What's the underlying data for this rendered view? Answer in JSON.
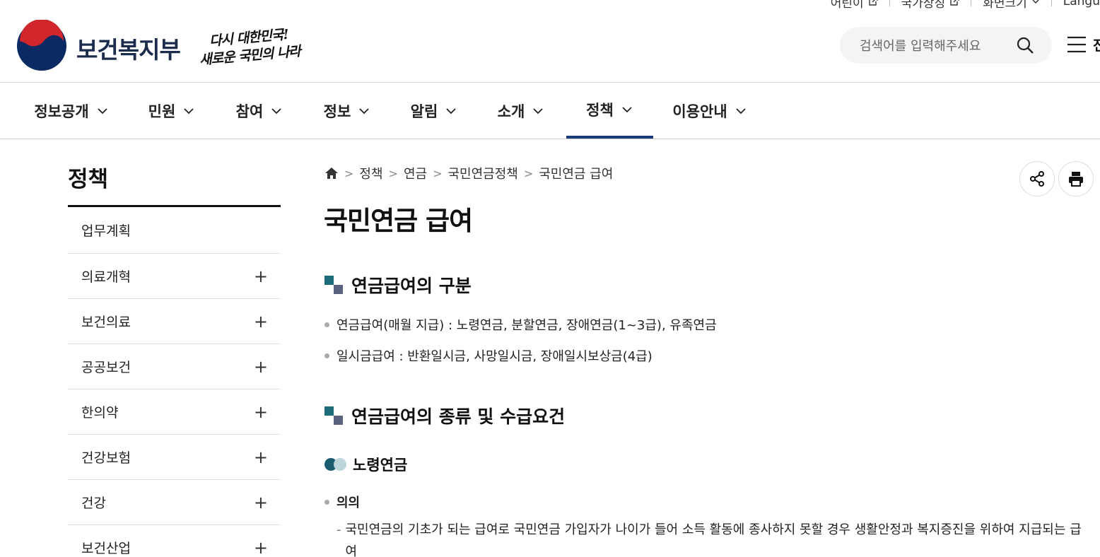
{
  "util": {
    "items": [
      {
        "label": "어린이",
        "icon": "external-link-icon"
      },
      {
        "label": "국가상징",
        "icon": "external-link-icon"
      },
      {
        "label": "화면크기",
        "icon": "chevron-down-icon"
      },
      {
        "label": "Langu",
        "icon": ""
      }
    ]
  },
  "header": {
    "ministry_name": "보건복지부",
    "slogan_line1": "다시 대한민국!",
    "slogan_line2": "새로운 국민의 나라",
    "search_placeholder": "검색어를 입력해주세요",
    "menu_cut_text": "전"
  },
  "gnb": {
    "items": [
      {
        "label": "정보공개"
      },
      {
        "label": "민원"
      },
      {
        "label": "참여"
      },
      {
        "label": "정보"
      },
      {
        "label": "알림"
      },
      {
        "label": "소개"
      },
      {
        "label": "정책"
      },
      {
        "label": "이용안내"
      }
    ],
    "active": "정책"
  },
  "sidebar": {
    "title": "정책",
    "items": [
      {
        "label": "업무계획",
        "expand": ""
      },
      {
        "label": "의료개혁",
        "expand": "+"
      },
      {
        "label": "보건의료",
        "expand": "+"
      },
      {
        "label": "공공보건",
        "expand": "+"
      },
      {
        "label": "한의약",
        "expand": "+"
      },
      {
        "label": "건강보험",
        "expand": "+"
      },
      {
        "label": "건강",
        "expand": "+"
      },
      {
        "label": "보건산업",
        "expand": "+"
      }
    ]
  },
  "breadcrumb": {
    "sep": ">",
    "items": [
      "정책",
      "연금",
      "국민연금정책",
      "국민연금 급여"
    ]
  },
  "page": {
    "title": "국민연금 급여",
    "section1_title": "연금급여의 구분",
    "section1_bullets": [
      "연금급여(매월 지급) : 노령연금, 분할연금, 장애연금(1~3급), 유족연금",
      "일시금급여 : 반환일시금, 사망일시금, 장애일시보상금(4급)"
    ],
    "section2_title": "연금급여의 종류 및 수급요건",
    "subsection_title": "노령연금",
    "meaning_label": "의의",
    "meaning_dash": "-",
    "meaning_desc": "국민연금의 기초가 되는 급여로 국민연금 가입자가 나이가 들어 소득 활동에 종사하지 못할 경우 생활안정과 복지증진을 위하여 지급되는 급여"
  },
  "colors": {
    "accent": "#1a3a7a",
    "square_primary": "#1b6b78",
    "square_secondary": "#5a6280"
  }
}
